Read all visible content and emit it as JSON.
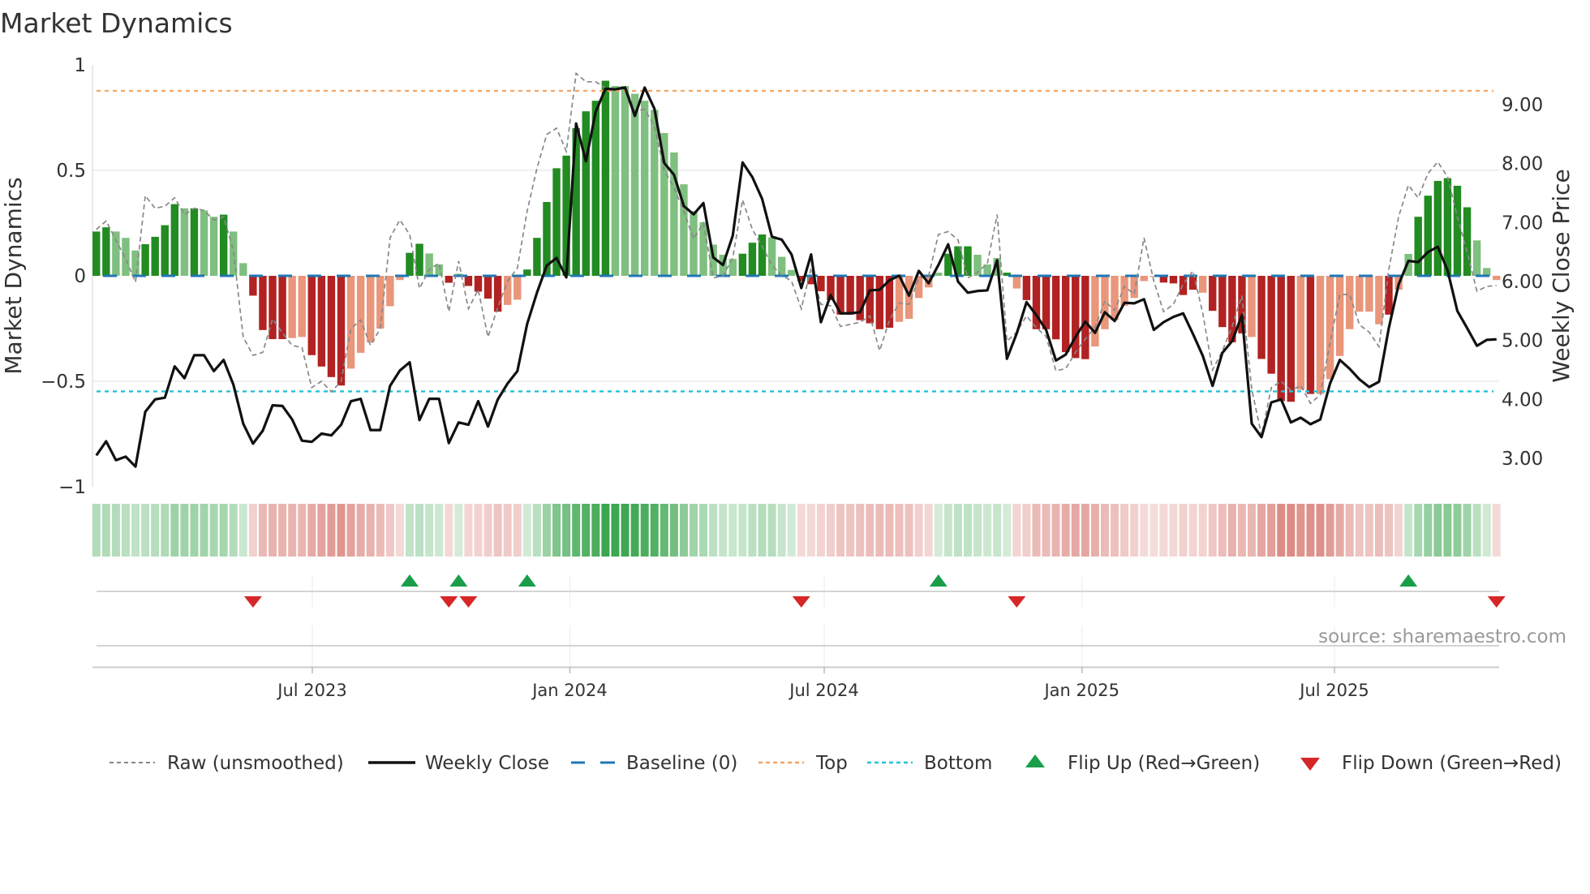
{
  "chart_data": {
    "type": "bar",
    "title": "Market Dynamics",
    "ylabel": "Market Dynamics",
    "y2label": "Weekly Close Price",
    "ylim": [
      -1,
      1
    ],
    "y2lim": [
      2.52,
      9.67
    ],
    "yticks": [
      1,
      0.5,
      0,
      -0.5,
      -1
    ],
    "ytick_labels": [
      "1",
      "0.5",
      "0",
      "−0.5",
      "−1"
    ],
    "y2ticks": [
      9,
      8,
      7,
      6,
      5,
      4,
      3
    ],
    "y2tick_labels": [
      "9.00",
      "8.00",
      "7.00",
      "6.00",
      "5.00",
      "4.00",
      "3.00"
    ],
    "x_unit": "week index",
    "xticks": [
      22.06,
      48.36,
      74.34,
      100.66,
      126.45
    ],
    "xtick_labels": [
      "Jul 2023",
      "Jan 2024",
      "Jul 2024",
      "Jan 2025",
      "Jul 2025"
    ],
    "grid": true,
    "top_level": 0.877,
    "bottom_level": -0.548,
    "baseline": 0,
    "dynamics": [
      0.21,
      0.23,
      0.21,
      0.18,
      0.12,
      0.15,
      0.185,
      0.24,
      0.34,
      0.32,
      0.32,
      0.31,
      0.28,
      0.29,
      0.21,
      0.06,
      -0.094,
      -0.257,
      -0.3,
      -0.3,
      -0.295,
      -0.29,
      -0.376,
      -0.43,
      -0.48,
      -0.52,
      -0.44,
      -0.365,
      -0.315,
      -0.25,
      -0.144,
      -0.02,
      0.109,
      0.152,
      0.106,
      0.054,
      -0.033,
      0.01,
      -0.048,
      -0.075,
      -0.108,
      -0.17,
      -0.138,
      -0.113,
      0.03,
      0.18,
      0.35,
      0.51,
      0.57,
      0.7,
      0.78,
      0.83,
      0.925,
      0.9,
      0.9,
      0.863,
      0.83,
      0.787,
      0.677,
      0.585,
      0.434,
      0.307,
      0.254,
      0.148,
      0.1,
      0.08,
      0.105,
      0.157,
      0.196,
      0.182,
      0.09,
      0.028,
      -0.025,
      -0.04,
      -0.073,
      -0.115,
      -0.184,
      -0.184,
      -0.21,
      -0.225,
      -0.253,
      -0.246,
      -0.218,
      -0.204,
      -0.105,
      -0.055,
      0.015,
      0.105,
      0.14,
      0.14,
      0.1,
      0.054,
      0.085,
      0.015,
      -0.06,
      -0.115,
      -0.253,
      -0.253,
      -0.301,
      -0.362,
      -0.39,
      -0.395,
      -0.335,
      -0.253,
      -0.21,
      -0.142,
      -0.105,
      -0.025,
      -0.005,
      -0.032,
      -0.036,
      -0.091,
      -0.066,
      -0.08,
      -0.166,
      -0.243,
      -0.315,
      -0.273,
      -0.29,
      -0.394,
      -0.464,
      -0.594,
      -0.597,
      -0.54,
      -0.56,
      -0.56,
      -0.49,
      -0.38,
      -0.253,
      -0.17,
      -0.17,
      -0.23,
      -0.184,
      -0.066,
      0.104,
      0.28,
      0.38,
      0.45,
      0.463,
      0.427,
      0.325,
      0.168,
      0.037,
      -0.02
    ],
    "shade": "ddlllddddldlldllddddllddddllllllddlldlddddlldddddddddllllllllllllldddlllddddddddddllllldddllldldddddddlllllllddddlddddlddddldllllllldllddddddllllld",
    "raw": [
      0.22,
      0.26,
      0.17,
      0.08,
      -0.03,
      0.38,
      0.32,
      0.33,
      0.37,
      0.29,
      0.32,
      0.31,
      0.265,
      0.28,
      0.12,
      -0.29,
      -0.377,
      -0.363,
      -0.204,
      -0.27,
      -0.33,
      -0.34,
      -0.53,
      -0.5,
      -0.55,
      -0.5,
      -0.25,
      -0.21,
      -0.33,
      -0.25,
      0.18,
      0.265,
      0.196,
      -0.06,
      0.03,
      0.06,
      -0.17,
      0.07,
      -0.156,
      -0.066,
      -0.29,
      -0.15,
      -0.025,
      0.037,
      0.307,
      0.51,
      0.67,
      0.7,
      0.59,
      0.96,
      0.92,
      0.92,
      0.89,
      0.887,
      0.9,
      0.78,
      0.79,
      0.71,
      0.5,
      0.417,
      0.307,
      0.175,
      0.25,
      -0.01,
      0.0,
      0.086,
      0.36,
      0.22,
      0.14,
      0.05,
      0.003,
      -0.025,
      -0.156,
      0.037,
      -0.135,
      -0.142,
      -0.24,
      -0.23,
      -0.22,
      -0.19,
      -0.355,
      -0.21,
      -0.128,
      -0.135,
      -0.01,
      0.0,
      0.196,
      0.21,
      0.17,
      -0.01,
      0.017,
      0.058,
      0.29,
      -0.31,
      -0.267,
      -0.19,
      -0.246,
      -0.287,
      -0.45,
      -0.44,
      -0.363,
      -0.3,
      -0.243,
      -0.12,
      -0.163,
      -0.05,
      -0.087,
      0.18,
      -0.025,
      -0.17,
      -0.135,
      -0.039,
      0.023,
      -0.177,
      -0.446,
      -0.356,
      -0.24,
      -0.094,
      -0.536,
      -0.757,
      -0.53,
      -0.5,
      -0.543,
      -0.52,
      -0.605,
      -0.564,
      -0.315,
      -0.09,
      -0.087,
      -0.232,
      -0.267,
      -0.336,
      0.03,
      0.28,
      0.43,
      0.37,
      0.486,
      0.54,
      0.47,
      0.28,
      0.113,
      -0.073,
      -0.05,
      -0.046
    ],
    "weekly_close": [
      3.05,
      3.29,
      2.97,
      3.03,
      2.86,
      3.79,
      4.0,
      4.03,
      4.56,
      4.36,
      4.75,
      4.75,
      4.48,
      4.67,
      4.25,
      3.59,
      3.25,
      3.47,
      3.9,
      3.89,
      3.66,
      3.3,
      3.28,
      3.42,
      3.39,
      3.57,
      3.97,
      4.01,
      3.48,
      3.48,
      4.23,
      4.49,
      4.63,
      3.65,
      4.01,
      4.01,
      3.26,
      3.61,
      3.57,
      3.97,
      3.54,
      4.0,
      4.27,
      4.48,
      5.28,
      5.81,
      6.27,
      6.4,
      6.07,
      8.68,
      8.04,
      8.88,
      9.27,
      9.26,
      9.29,
      8.81,
      9.29,
      8.93,
      8.01,
      7.81,
      7.28,
      7.14,
      7.33,
      6.41,
      6.28,
      6.78,
      8.02,
      7.77,
      7.4,
      6.76,
      6.71,
      6.46,
      5.89,
      6.46,
      5.31,
      5.77,
      5.46,
      5.46,
      5.48,
      5.85,
      5.86,
      6.02,
      6.1,
      5.76,
      6.18,
      5.97,
      6.28,
      6.63,
      6.0,
      5.81,
      5.84,
      5.85,
      6.36,
      4.69,
      5.12,
      5.65,
      5.43,
      5.18,
      4.66,
      4.76,
      5.06,
      5.32,
      5.13,
      5.48,
      5.33,
      5.64,
      5.63,
      5.7,
      5.18,
      5.31,
      5.4,
      5.46,
      5.11,
      4.74,
      4.23,
      4.79,
      4.99,
      5.43,
      3.59,
      3.36,
      3.95,
      4.0,
      3.61,
      3.69,
      3.58,
      3.66,
      4.27,
      4.67,
      4.52,
      4.34,
      4.21,
      4.3,
      5.21,
      5.95,
      6.35,
      6.33,
      6.5,
      6.59,
      6.19,
      5.5,
      5.21,
      4.91,
      5.01,
      5.02
    ],
    "flip_up_weeks": [
      32,
      37,
      44,
      86,
      134
    ],
    "flip_down_weeks": [
      16,
      36,
      38,
      72,
      94,
      143
    ],
    "legend": {
      "placement": "bottom",
      "raw": "Raw (unsmoothed)",
      "close": "Weekly Close",
      "baseline": "Baseline (0)",
      "top": "Top",
      "bottom": "Bottom",
      "flip_up": "Flip Up (Red→Green)",
      "flip_down": "Flip Down (Green→Red)"
    },
    "source": "source: sharemaestro.com",
    "colors": {
      "green_strong": "#228b22",
      "green_weak": "#7fbf7f",
      "red_strong": "#b22222",
      "red_weak": "#e9967a",
      "raw": "#888888",
      "close": "#111111",
      "baseline": "#1f77b4",
      "top": "#f4a460",
      "bottom": "#22c3d6",
      "flip_up": "#1a9e4a",
      "flip_down": "#d62728",
      "strip_green": "46,160,67",
      "strip_red": "205,85,75"
    }
  }
}
